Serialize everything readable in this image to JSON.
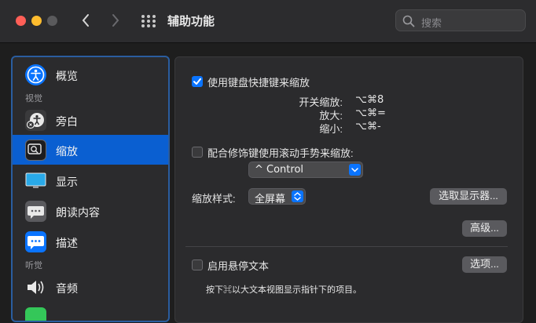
{
  "window": {
    "title": "辅助功能"
  },
  "search": {
    "placeholder": "搜索"
  },
  "sidebar": {
    "items": [
      {
        "label": "概览",
        "icon": "accessibility-person-icon",
        "color": "#0a74ff"
      },
      {
        "label": "旁白",
        "icon": "voiceover-icon",
        "color": "#3a3a3c"
      },
      {
        "label": "缩放",
        "icon": "zoom-icon",
        "color": "#1d1d1f"
      },
      {
        "label": "显示",
        "icon": "display-icon",
        "color": "#29a9e8"
      },
      {
        "label": "朗读内容",
        "icon": "speech-bubble-icon",
        "color": "#5a5a5e"
      },
      {
        "label": "描述",
        "icon": "descriptions-icon",
        "color": "#0a74ff"
      },
      {
        "label": "音频",
        "icon": "speaker-icon",
        "color": "#8a8a8e"
      }
    ],
    "sections": {
      "vision": "视觉",
      "hearing": "听觉"
    },
    "selected": "缩放"
  },
  "zoom": {
    "keyboard_shortcuts_label": "使用键盘快捷键来缩放",
    "keyboard_shortcuts_checked": true,
    "shortcuts": [
      {
        "label": "开关缩放:",
        "keys": "⌥⌘8"
      },
      {
        "label": "放大:",
        "keys": "⌥⌘="
      },
      {
        "label": "缩小:",
        "keys": "⌥⌘-"
      }
    ],
    "scroll_gesture_label": "配合修饰键使用滚动手势来缩放:",
    "scroll_gesture_checked": false,
    "modifier_value": "^ Control",
    "zoom_style_label": "缩放样式:",
    "zoom_style_value": "全屏幕",
    "choose_display_label": "选取显示器...",
    "advanced_label": "高级...",
    "hover_text_label": "启用悬停文本",
    "hover_text_checked": false,
    "options_label": "选项...",
    "hover_hint": "按下⌘以大文本视图显示指针下的项目。"
  },
  "colors": {
    "accent": "#0a74ff",
    "selection": "#0a5fd1"
  }
}
